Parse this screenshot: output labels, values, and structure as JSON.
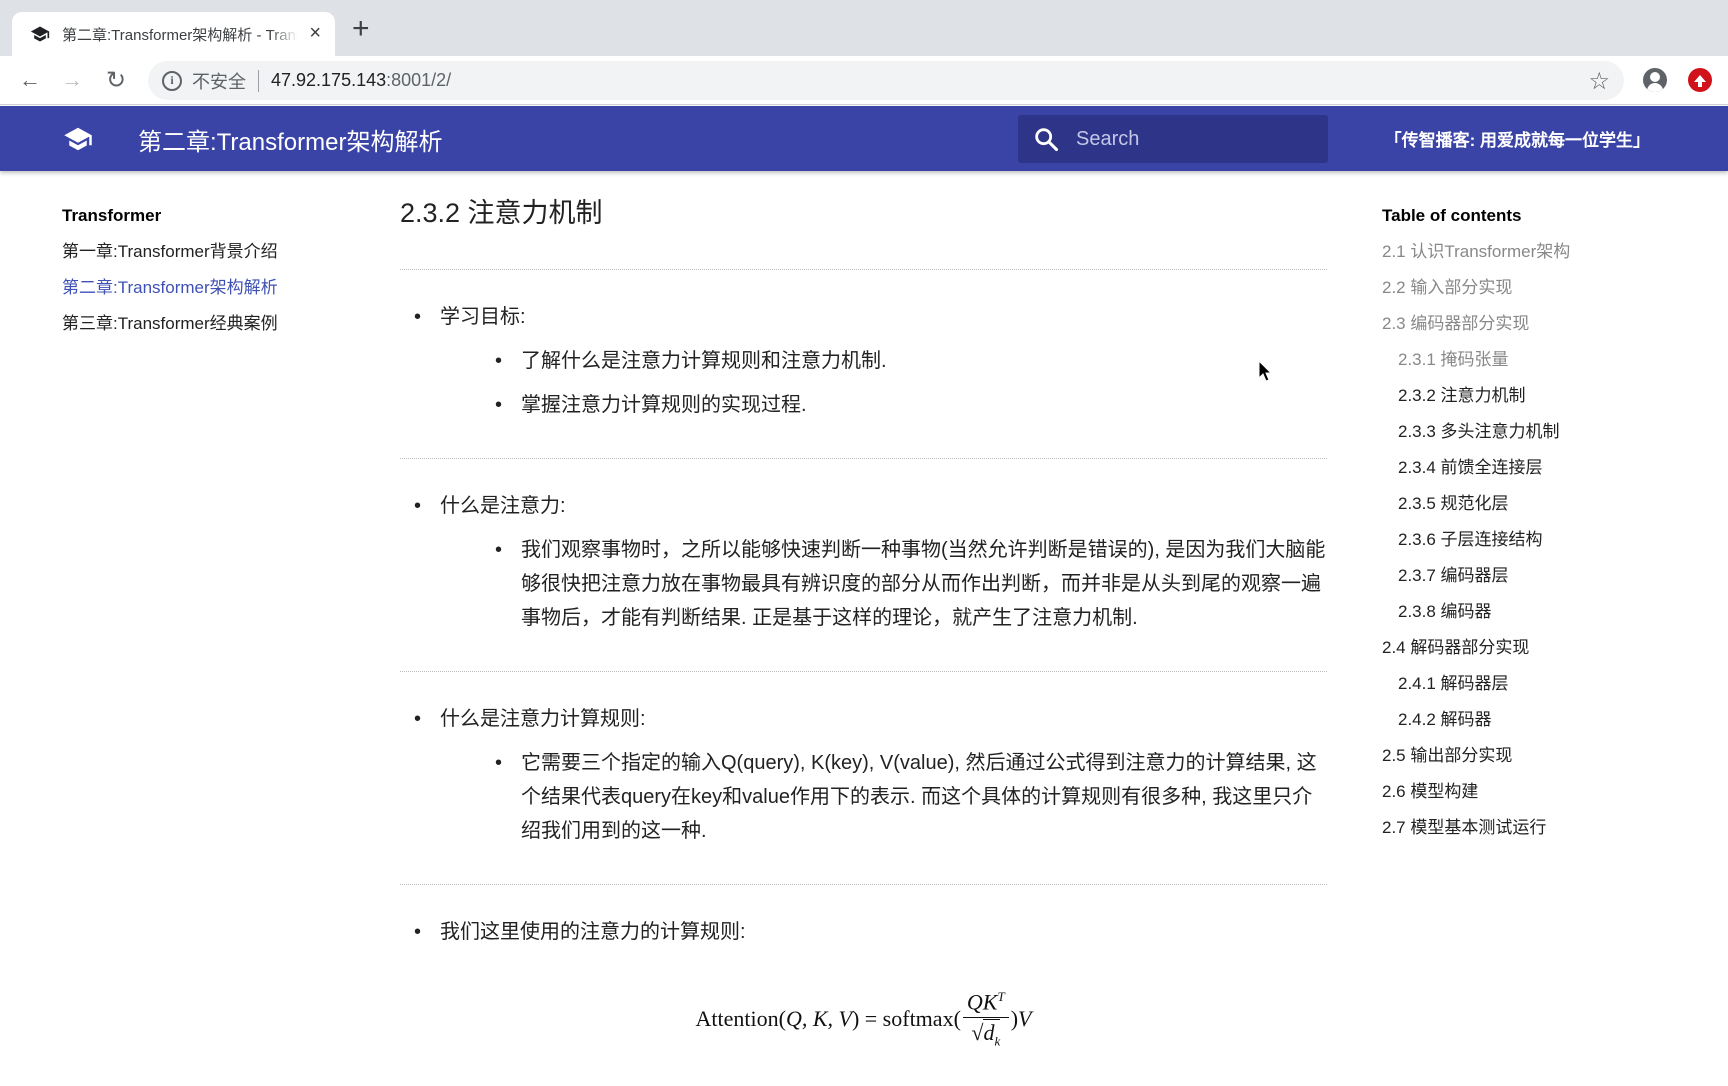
{
  "browser": {
    "tab_title": "第二章:Transformer架构解析 - Transformer",
    "new_tab_label": "+",
    "close_tab_label": "×",
    "security_label": "不安全",
    "url_host": "47.92.175.143",
    "url_path": ":8001/2/",
    "icons": {
      "back": "arrow-left-icon",
      "forward": "arrow-right-icon",
      "reload": "reload-icon",
      "info": "info-icon",
      "bookmark": "star-icon",
      "profile": "account-icon",
      "extension": "upload-icon"
    },
    "back_glyph": "←",
    "forward_glyph": "→",
    "reload_glyph": "↻",
    "info_glyph": "i",
    "star_glyph": "☆"
  },
  "header": {
    "title": "第二章:Transformer架构解析",
    "search_placeholder": "Search",
    "tagline": "「传智播客: 用爱成就每一位学生」",
    "brand_color": "#3a43a6"
  },
  "leftnav": {
    "title": "Transformer",
    "items": [
      {
        "label": "第一章:Transformer背景介绍",
        "active": false
      },
      {
        "label": "第二章:Transformer架构解析",
        "active": true
      },
      {
        "label": "第三章:Transformer经典案例",
        "active": false
      }
    ]
  },
  "content": {
    "heading": "2.3.2 注意力机制",
    "sections": [
      {
        "label": "学习目标:",
        "items": [
          "了解什么是注意力计算规则和注意力机制.",
          "掌握注意力计算规则的实现过程."
        ]
      },
      {
        "label": "什么是注意力:",
        "items": [
          "我们观察事物时，之所以能够快速判断一种事物(当然允许判断是错误的), 是因为我们大脑能够很快把注意力放在事物最具有辨识度的部分从而作出判断，而并非是从头到尾的观察一遍事物后，才能有判断结果. 正是基于这样的理论，就产生了注意力机制."
        ]
      },
      {
        "label": "什么是注意力计算规则:",
        "items": [
          "它需要三个指定的输入Q(query), K(key), V(value), 然后通过公式得到注意力的计算结果, 这个结果代表query在key和value作用下的表示. 而这个具体的计算规则有很多种, 我这里只介绍我们用到的这一种."
        ]
      },
      {
        "label": "我们这里使用的注意力的计算规则:"
      }
    ],
    "formula": {
      "lhs": "Attention(",
      "lhs_args": "Q, K, V",
      "lhs_close": ") = softmax(",
      "numerator": "QK",
      "numerator_sup": "T",
      "denominator_root": "√",
      "denominator": "d",
      "denominator_sub": "k",
      "rhs_close": ")",
      "rhs_var": "V"
    }
  },
  "toc": {
    "title": "Table of contents",
    "items": [
      {
        "label": "2.1 认识Transformer架构",
        "level": 1,
        "state": "past"
      },
      {
        "label": "2.2 输入部分实现",
        "level": 1,
        "state": "past"
      },
      {
        "label": "2.3 编码器部分实现",
        "level": 1,
        "state": "past"
      },
      {
        "label": "2.3.1 掩码张量",
        "level": 2,
        "state": "past"
      },
      {
        "label": "2.3.2 注意力机制",
        "level": 2,
        "state": "current"
      },
      {
        "label": "2.3.3 多头注意力机制",
        "level": 2,
        "state": "normal"
      },
      {
        "label": "2.3.4 前馈全连接层",
        "level": 2,
        "state": "normal"
      },
      {
        "label": "2.3.5 规范化层",
        "level": 2,
        "state": "normal"
      },
      {
        "label": "2.3.6 子层连接结构",
        "level": 2,
        "state": "normal"
      },
      {
        "label": "2.3.7 编码器层",
        "level": 2,
        "state": "normal"
      },
      {
        "label": "2.3.8 编码器",
        "level": 2,
        "state": "normal"
      },
      {
        "label": "2.4 解码器部分实现",
        "level": 1,
        "state": "normal"
      },
      {
        "label": "2.4.1 解码器层",
        "level": 2,
        "state": "normal"
      },
      {
        "label": "2.4.2 解码器",
        "level": 2,
        "state": "normal"
      },
      {
        "label": "2.5 输出部分实现",
        "level": 1,
        "state": "normal"
      },
      {
        "label": "2.6 模型构建",
        "level": 1,
        "state": "normal"
      },
      {
        "label": "2.7 模型基本测试运行",
        "level": 1,
        "state": "normal"
      }
    ]
  }
}
